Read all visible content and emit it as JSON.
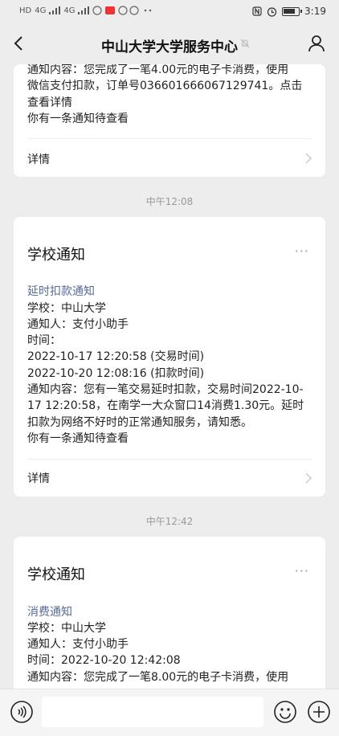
{
  "status_bar": {
    "left_labels": [
      "HD",
      "4G",
      "4G"
    ],
    "time": "3:19"
  },
  "header": {
    "title": "中山大学大学服务中心",
    "back_icon": "chevron-left-icon",
    "mute_icon": "bell-off-icon",
    "profile_icon": "person-icon"
  },
  "card_top": {
    "lines": [
      "通知内容：您完成了一笔4.00元的电子卡消费，使用",
      "微信支付扣款，订单号036601666067129741。点击",
      "查看详情",
      "你有一条通知待查看"
    ],
    "detail_label": "详情"
  },
  "timestamp_1": "中午12:08",
  "card_1": {
    "title": "学校通知",
    "more": "···",
    "notice_type": "延时扣款通知",
    "lines": [
      "学校：中山大学",
      "通知人：支付小助手",
      "时间：",
      "2022-10-17 12:20:58 (交易时间)",
      "2022-10-20 12:08:16 (扣款时间)",
      "通知内容：您有一笔交易延时扣款，交易时间2022-10-",
      "17 12:20:58，在南学一大众窗口14消费1.30元。延时",
      "扣款为网络不好时的正常通知服务，请知悉。",
      "你有一条通知待查看"
    ],
    "detail_label": "详情"
  },
  "timestamp_2": "中午12:42",
  "card_2": {
    "title": "学校通知",
    "more": "···",
    "notice_type": "消费通知",
    "lines": [
      "学校：中山大学",
      "通知人：支付小助手",
      "时间：2022-10-20 12:42:08",
      "通知内容：您完成了一笔8.00元的电子卡消费，使用"
    ]
  },
  "input_bar": {
    "voice_icon": "voice-icon",
    "emoji_icon": "emoji-icon",
    "plus_icon": "plus-circle-icon"
  }
}
